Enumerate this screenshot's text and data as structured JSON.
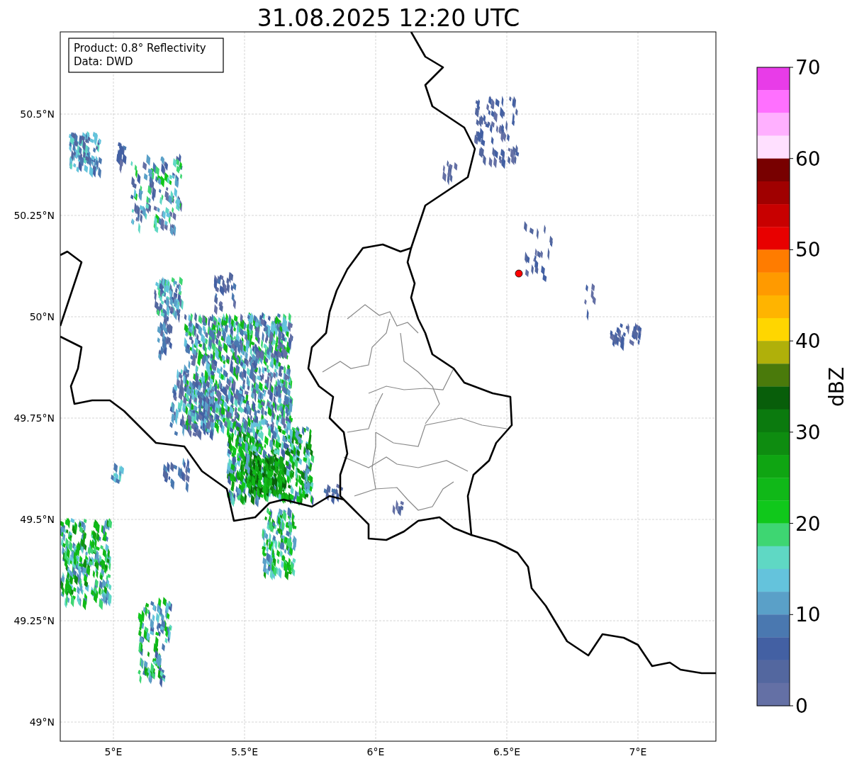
{
  "title": "31.08.2025 12:20 UTC",
  "legend": {
    "lines": [
      "Product: 0.8° Reflectivity",
      "Data: DWD"
    ]
  },
  "x_axis": {
    "ticks": [
      "5°E",
      "5.5°E",
      "6°E",
      "6.5°E",
      "7°E"
    ]
  },
  "y_axis": {
    "ticks": [
      "50.5°N",
      "50.25°N",
      "50°N",
      "49.75°N",
      "49.5°N",
      "49.25°N",
      "49°N"
    ]
  },
  "colorbar": {
    "label": "dBZ",
    "ticks": [
      "70",
      "60",
      "50",
      "40",
      "30",
      "20",
      "10",
      "0"
    ],
    "bins": [
      {
        "color": "#e83ce8"
      },
      {
        "color": "#ff70ff"
      },
      {
        "color": "#ffb0ff"
      },
      {
        "color": "#ffe0ff"
      },
      {
        "color": "#780000"
      },
      {
        "color": "#a00000"
      },
      {
        "color": "#c80000"
      },
      {
        "color": "#e80000"
      },
      {
        "color": "#ff7c00"
      },
      {
        "color": "#ff9a00"
      },
      {
        "color": "#ffb400"
      },
      {
        "color": "#ffd600"
      },
      {
        "color": "#b0b00a"
      },
      {
        "color": "#4a7a0b"
      },
      {
        "color": "#085e0a"
      },
      {
        "color": "#0b7a0e"
      },
      {
        "color": "#0e8c10"
      },
      {
        "color": "#0fa512"
      },
      {
        "color": "#10b818"
      },
      {
        "color": "#10c81b"
      },
      {
        "color": "#3ed672"
      },
      {
        "color": "#5fd8c4"
      },
      {
        "color": "#64c3dc"
      },
      {
        "color": "#5aa0c8"
      },
      {
        "color": "#4a78b0"
      },
      {
        "color": "#4360a3"
      },
      {
        "color": "#53679f"
      },
      {
        "color": "#6470a5"
      }
    ]
  }
}
